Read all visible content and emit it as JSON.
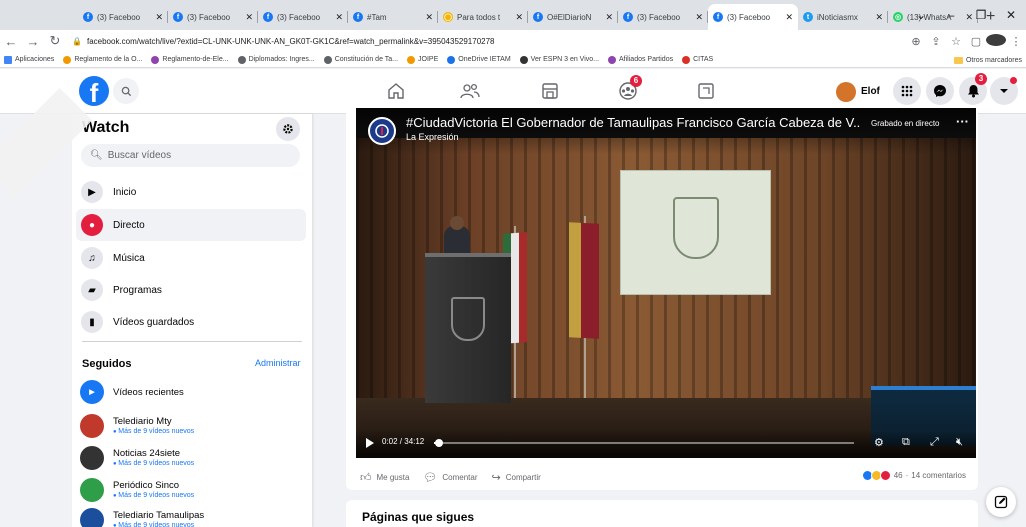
{
  "browser": {
    "tabs": [
      {
        "title": "(3) Faceboo",
        "fav": "fb",
        "active": false
      },
      {
        "title": "(3) Faceboo",
        "fav": "fb",
        "active": false
      },
      {
        "title": "(3) Faceboo",
        "fav": "fb",
        "active": false
      },
      {
        "title": "#Tam",
        "fav": "ff",
        "active": false
      },
      {
        "title": "Para todos t",
        "fav": "pt",
        "active": false
      },
      {
        "title": "O#ElDiarioN",
        "fav": "ff",
        "active": false
      },
      {
        "title": "(3) Faceboo",
        "fav": "fb",
        "active": false
      },
      {
        "title": "(3) Faceboo",
        "fav": "fb",
        "active": true
      },
      {
        "title": "iNoticiasmx",
        "fav": "tw",
        "active": false
      },
      {
        "title": "(13) WhatsA",
        "fav": "wa",
        "active": false
      }
    ],
    "url": "facebook.com/watch/live/?extid=CL-UNK-UNK-UNK-AN_GK0T-GK1C&ref=watch_permalink&v=395043529170278",
    "bookmarks": [
      "Aplicaciones",
      "Reglamento de la O...",
      "Reglamento-de-Ele...",
      "Diplomados: Ingres...",
      "Constitución de Ta...",
      "JOIPE",
      "OneDrive IETAM",
      "Ver ESPN 3 en Vivo...",
      "Afiliados Partidos",
      "CITAS"
    ],
    "other_bookmarks": "Otros marcadores"
  },
  "fb": {
    "logo": "f",
    "user_name": "Elof",
    "groups_badge": "6",
    "notif_badge": "3"
  },
  "sidebar": {
    "title": "Watch",
    "search_placeholder": "Buscar vídeos",
    "items": [
      {
        "label": "Inicio",
        "icon": "video-home-icon"
      },
      {
        "label": "Directo",
        "icon": "live-icon"
      },
      {
        "label": "Música",
        "icon": "music-icon"
      },
      {
        "label": "Programas",
        "icon": "shows-icon"
      },
      {
        "label": "Vídeos guardados",
        "icon": "saved-icon"
      }
    ],
    "section_title": "Seguidos",
    "manage_label": "Administrar",
    "recent_label": "Vídeos recientes",
    "following": [
      {
        "name": "Telediario Mty",
        "sub": "Más de 9 vídeos nuevos",
        "color": "#c0392b"
      },
      {
        "name": "Noticias 24siete",
        "sub": "Más de 9 vídeos nuevos",
        "color": "#333333"
      },
      {
        "name": "Periódico Sinco",
        "sub": "Más de 9 vídeos nuevos",
        "color": "#2e9e48"
      },
      {
        "name": "Telediario Tamaulipas",
        "sub": "Más de 9 vídeos nuevos",
        "color": "#1b4f9c"
      }
    ]
  },
  "video": {
    "title": "#CiudadVictoria El Gobernador de Tamaulipas Francisco García Cabeza de V...",
    "channel": "La Expresión",
    "live_label": "Grabado en directo",
    "time": "0:02 / 34:12",
    "progress": 0.001,
    "like_label": "Me gusta",
    "comment_label": "Comentar",
    "share_label": "Compartir",
    "reactions_count": "46",
    "comments_count": "14 comentarios"
  },
  "pages_section": {
    "title": "Páginas que sigues"
  }
}
